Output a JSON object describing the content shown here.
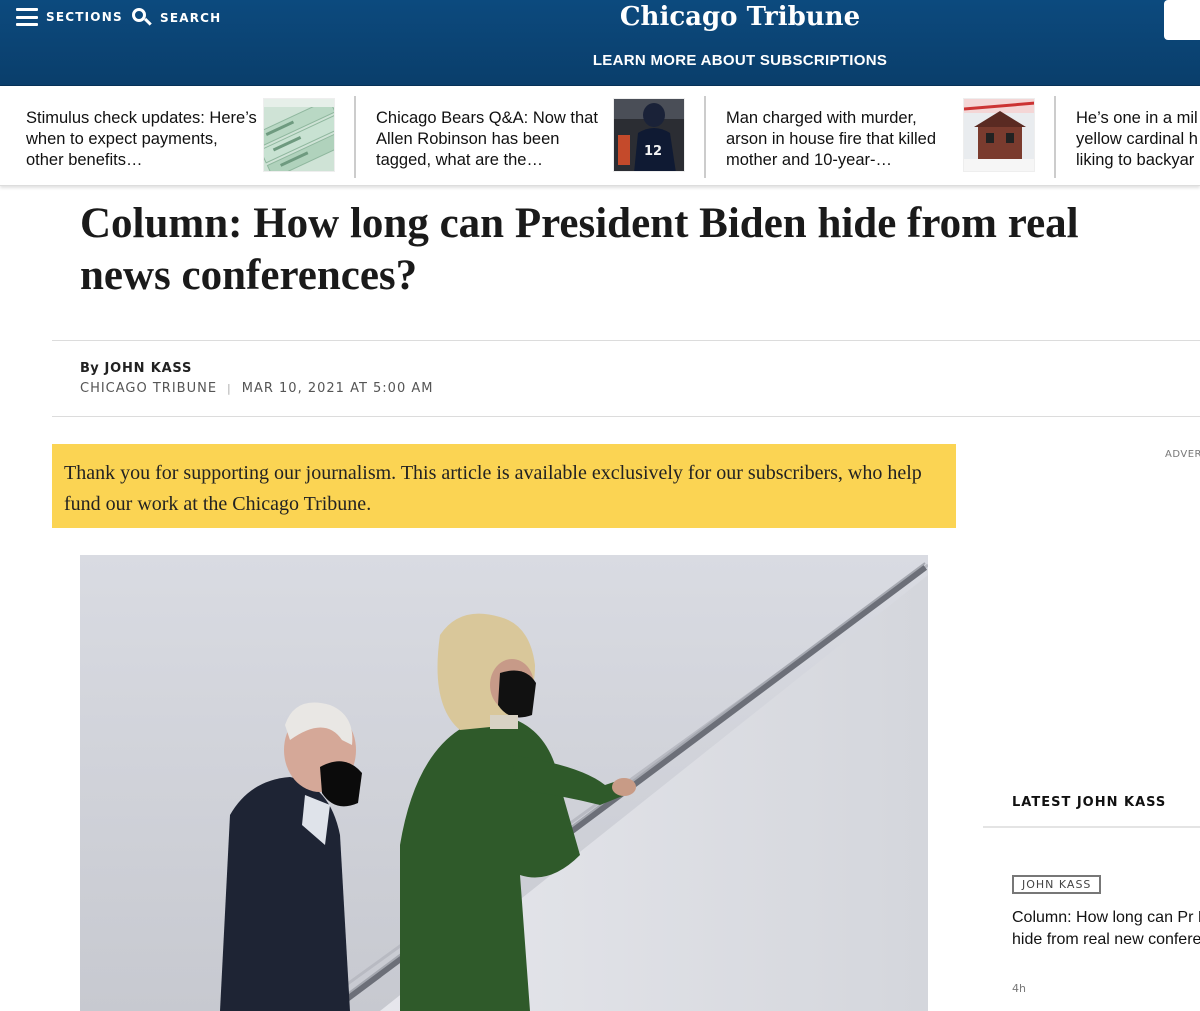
{
  "header": {
    "sections_label": "SECTIONS",
    "search_label": "SEARCH",
    "logo_text": "Chicago Tribune",
    "subscribe_link": "LEARN MORE ABOUT SUBSCRIPTIONS"
  },
  "carousel": {
    "items": [
      {
        "text": "Stimulus check updates: Here’s when to expect payments, other benefits…",
        "thumb": "stimulus-check-image"
      },
      {
        "text": "Chicago Bears Q&A: Now that Allen Robinson has been tagged, what are the…",
        "thumb": "football-player-image"
      },
      {
        "text": "Man charged with murder, arson in house fire that killed mother and 10-year-…",
        "thumb": "burned-house-image"
      },
      {
        "text": "He’s one in a mil yellow cardinal h liking to backyar"
      }
    ]
  },
  "article": {
    "headline": "Column: How long can President Biden hide from real news conferences?",
    "by_prefix": "By",
    "author": "JOHN KASS",
    "publication": "CHICAGO TRIBUNE",
    "separator": "|",
    "date": "MAR 10, 2021 AT 5:00 AM",
    "subscriber_notice": "Thank you for supporting our journalism. This article is available exclusively for our subscribers, who help fund our work at the Chicago Tribune."
  },
  "sidebar": {
    "advert_label": "ADVERT",
    "latest_title": "LATEST JOHN KASS",
    "latest_item": {
      "tag": "JOHN KASS",
      "headline": "Column: How long can Pr Biden hide from real new conferences?",
      "time": "4h"
    }
  },
  "colors": {
    "header_blue": "#0c4a7e",
    "notice_yellow": "#fbd453"
  }
}
